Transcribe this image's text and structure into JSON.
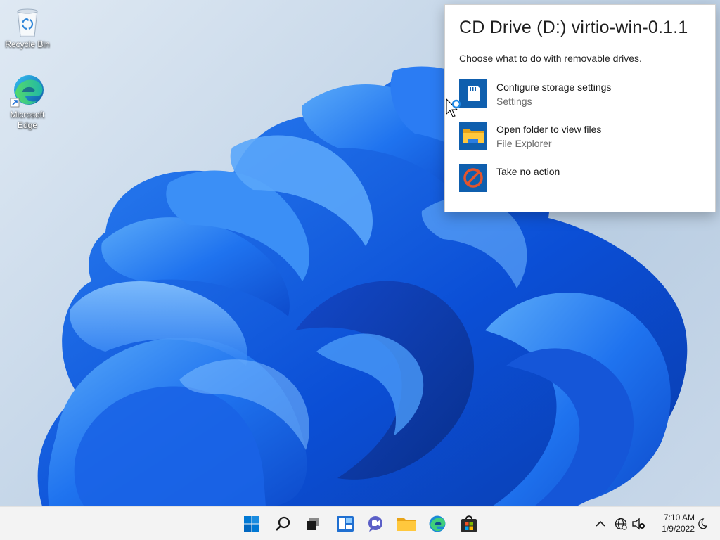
{
  "desktop": {
    "icons": [
      {
        "label": "Recycle Bin"
      },
      {
        "label": "Microsoft Edge"
      }
    ]
  },
  "autoplay": {
    "title": "CD Drive (D:) virtio-win-0.1.1",
    "subtitle": "Choose what to do with removable drives.",
    "options": [
      {
        "primary": "Configure storage settings",
        "secondary": "Settings",
        "icon": "sd-card-icon"
      },
      {
        "primary": "Open folder to view files",
        "secondary": "File Explorer",
        "icon": "folder-icon"
      },
      {
        "primary": "Take no action",
        "secondary": "",
        "icon": "no-action-icon"
      }
    ]
  },
  "taskbar": {
    "apps": [
      "start-icon",
      "search-icon",
      "task-view-icon",
      "widgets-icon",
      "chat-icon",
      "file-explorer-icon",
      "edge-icon",
      "store-icon"
    ],
    "tray": [
      "chevron-up-icon",
      "network-icon",
      "volume-muted-icon"
    ],
    "clock": {
      "time": "7:10 AM",
      "date": "1/9/2022"
    },
    "notification_icon": "focus-moon-icon"
  },
  "colors": {
    "accent": "#0067c0",
    "bloom": "#1e6ff0",
    "flyout_icon_bg": "#0f5fae"
  }
}
